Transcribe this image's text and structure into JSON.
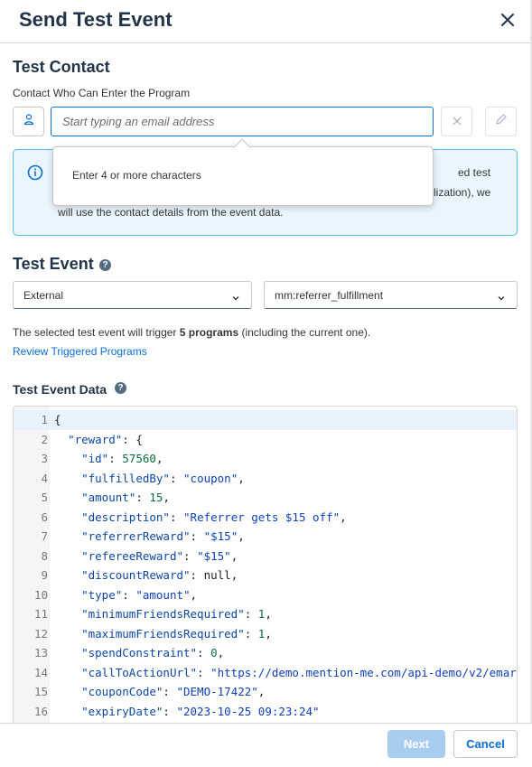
{
  "dialog": {
    "title": "Send Test Event",
    "close_icon": "close-icon"
  },
  "test_contact": {
    "heading": "Test Contact",
    "label": "Contact Who Can Enter the Program",
    "email_placeholder": "Start typing an email address",
    "email_value": "",
    "contact_icon": "person-icon",
    "clear_icon": "clear-x-icon",
    "edit_icon": "pencil-icon"
  },
  "info": {
    "icon": "info-icon",
    "line1": "ed test",
    "line2": "lization), we",
    "line3": "will use the contact details from the event data."
  },
  "suggestion_popover": {
    "text": "Enter 4 or more characters"
  },
  "test_event": {
    "heading": "Test Event",
    "source_select": "External",
    "event_select": "mm:referrer_fulfillment",
    "trigger_prefix": "The selected test event will trigger ",
    "trigger_count": "5 programs",
    "trigger_suffix": " (including the current one).",
    "review_link": "Review Triggered Programs"
  },
  "event_data": {
    "heading": "Test Event Data",
    "lines": [
      {
        "n": "1",
        "text": "{"
      },
      {
        "n": "2",
        "text": "  \"reward\": {"
      },
      {
        "n": "3",
        "text": "    \"id\": 57560,"
      },
      {
        "n": "4",
        "text": "    \"fulfilledBy\": \"coupon\","
      },
      {
        "n": "5",
        "text": "    \"amount\": 15,"
      },
      {
        "n": "6",
        "text": "    \"description\": \"Referrer gets $15 off\","
      },
      {
        "n": "7",
        "text": "    \"referrerReward\": \"$15\","
      },
      {
        "n": "8",
        "text": "    \"refereeReward\": \"$15\","
      },
      {
        "n": "9",
        "text": "    \"discountReward\": null,"
      },
      {
        "n": "10",
        "text": "    \"type\": \"amount\","
      },
      {
        "n": "11",
        "text": "    \"minimumFriendsRequired\": 1,"
      },
      {
        "n": "12",
        "text": "    \"maximumFriendsRequired\": 1,"
      },
      {
        "n": "13",
        "text": "    \"spendConstraint\": 0,"
      },
      {
        "n": "14",
        "text": "    \"callToActionUrl\": \"https://demo.mention-me.com/api-demo/v2/emar"
      },
      {
        "n": "15",
        "text": "    \"couponCode\": \"DEMO-17422\","
      },
      {
        "n": "16",
        "text": "    \"expiryDate\": \"2023-10-25 09:23:24\""
      }
    ]
  },
  "footer": {
    "next_label": "Next",
    "cancel_label": "Cancel"
  },
  "colors": {
    "accent": "#0a6ed1",
    "info_bg": "#eaf6fd",
    "info_border": "#5bb7f0",
    "primary_disabled": "#a9cdf1"
  }
}
